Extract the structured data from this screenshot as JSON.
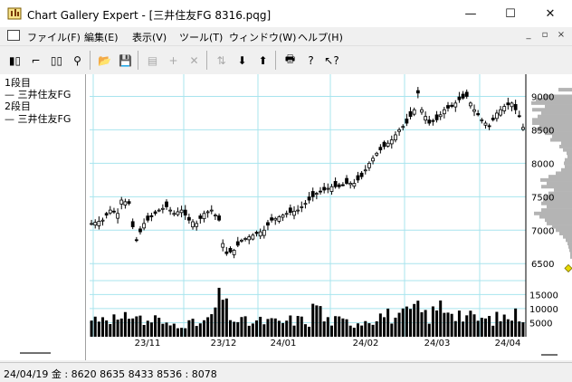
{
  "window": {
    "title": "Chart Gallery Expert - [三井住友FG 8316.pqg]",
    "minimize_glyph": "—",
    "maximize_glyph": "☐",
    "close_glyph": "✕"
  },
  "menu": {
    "items": [
      "ファイル(F)",
      "編集(E)",
      "表示(V)",
      "ツール(T)",
      "ウィンドウ(W)",
      "ヘルプ(H)"
    ],
    "mdi_minimize": "_",
    "mdi_restore": "▫",
    "mdi_close": "×"
  },
  "toolbar": {
    "buttons": [
      {
        "icon": "candlestick-chart-icon",
        "glyph": "▮▯",
        "enabled": true
      },
      {
        "icon": "step-chart-icon",
        "glyph": "⌐",
        "enabled": true
      },
      {
        "icon": "dual-pane-icon",
        "glyph": "▯▯",
        "enabled": true
      },
      {
        "icon": "binoculars-icon",
        "glyph": "⚲",
        "enabled": true
      },
      {
        "icon": "open-folder-icon",
        "glyph": "📂",
        "enabled": true
      },
      {
        "icon": "save-icon",
        "glyph": "💾",
        "enabled": true
      },
      {
        "icon": "properties-icon",
        "glyph": "▤",
        "enabled": false
      },
      {
        "icon": "add-icon",
        "glyph": "+",
        "enabled": false
      },
      {
        "icon": "delete-icon",
        "glyph": "✕",
        "enabled": false
      },
      {
        "icon": "sort-icon",
        "glyph": "⇅",
        "enabled": false
      },
      {
        "icon": "download-icon",
        "glyph": "⬇",
        "enabled": true
      },
      {
        "icon": "upload-icon",
        "glyph": "⬆",
        "enabled": true
      },
      {
        "icon": "print-icon",
        "glyph": "🖶",
        "enabled": true
      },
      {
        "icon": "help-icon",
        "glyph": "?",
        "enabled": true
      },
      {
        "icon": "context-help-icon",
        "glyph": "↖?",
        "enabled": true
      }
    ]
  },
  "left_panel": {
    "lines": [
      "1段目",
      "— 三井住友FG",
      "2段目",
      "— 三井住友FG"
    ]
  },
  "status": {
    "text": "24/04/19 金 : 8620 8635 8433 8536  : 8078"
  },
  "colors": {
    "grid": "#a8e4ee",
    "price": "#000000",
    "volume": "#000000",
    "histogram": "#b4b4b4",
    "marker": "#e6d800"
  },
  "chart_data": {
    "type": "candlestick",
    "x_ticks": [
      "23/11",
      "23/12",
      "24/01",
      "24/02",
      "24/03",
      "24/04"
    ],
    "price_ticks": [
      9000,
      8500,
      8000,
      7500,
      7000,
      6500
    ],
    "volume_ticks": [
      15000,
      10000,
      5000
    ],
    "price_range": [
      6300,
      9250
    ],
    "volume_range": [
      0,
      18000
    ],
    "grid": true,
    "series": [
      {
        "name": "三井住友FG",
        "close_keypoints": [
          [
            0,
            7100
          ],
          [
            3,
            7150
          ],
          [
            5,
            7300
          ],
          [
            7,
            7250
          ],
          [
            8,
            7450
          ],
          [
            10,
            7400
          ],
          [
            11,
            7050
          ],
          [
            12,
            6850
          ],
          [
            14,
            7100
          ],
          [
            16,
            7200
          ],
          [
            18,
            7300
          ],
          [
            20,
            7350
          ],
          [
            22,
            7250
          ],
          [
            24,
            7300
          ],
          [
            26,
            7150
          ],
          [
            28,
            7100
          ],
          [
            30,
            7250
          ],
          [
            32,
            7300
          ],
          [
            34,
            7150
          ],
          [
            35,
            6800
          ],
          [
            36,
            6650
          ],
          [
            38,
            6700
          ],
          [
            40,
            6850
          ],
          [
            42,
            6900
          ],
          [
            44,
            6950
          ],
          [
            46,
            7000
          ],
          [
            48,
            7150
          ],
          [
            50,
            7200
          ],
          [
            52,
            7250
          ],
          [
            55,
            7300
          ],
          [
            58,
            7450
          ],
          [
            60,
            7550
          ],
          [
            62,
            7600
          ],
          [
            64,
            7650
          ],
          [
            66,
            7650
          ],
          [
            68,
            7700
          ],
          [
            70,
            7700
          ],
          [
            72,
            7800
          ],
          [
            74,
            8000
          ],
          [
            76,
            8150
          ],
          [
            78,
            8250
          ],
          [
            80,
            8350
          ],
          [
            82,
            8500
          ],
          [
            84,
            8600
          ],
          [
            86,
            8800
          ],
          [
            87,
            9050
          ],
          [
            88,
            8800
          ],
          [
            89,
            8700
          ],
          [
            90,
            8600
          ],
          [
            92,
            8650
          ],
          [
            94,
            8800
          ],
          [
            96,
            8850
          ],
          [
            98,
            8950
          ],
          [
            100,
            9000
          ],
          [
            102,
            8800
          ],
          [
            104,
            8650
          ],
          [
            106,
            8550
          ],
          [
            108,
            8750
          ],
          [
            110,
            8850
          ],
          [
            112,
            8900
          ],
          [
            113,
            8800
          ],
          [
            114,
            8700
          ],
          [
            115,
            8536
          ]
        ],
        "volume_keypoints": [
          [
            0,
            6000
          ],
          [
            4,
            8000
          ],
          [
            8,
            5000
          ],
          [
            11,
            9000
          ],
          [
            14,
            5000
          ],
          [
            17,
            6500
          ],
          [
            20,
            4000
          ],
          [
            24,
            5000
          ],
          [
            28,
            4500
          ],
          [
            31,
            5500
          ],
          [
            35,
            15000
          ],
          [
            36,
            10000
          ],
          [
            38,
            6000
          ],
          [
            42,
            5000
          ],
          [
            46,
            5500
          ],
          [
            50,
            5000
          ],
          [
            54,
            6000
          ],
          [
            58,
            5500
          ],
          [
            60,
            13000
          ],
          [
            62,
            6000
          ],
          [
            66,
            5500
          ],
          [
            70,
            5000
          ],
          [
            74,
            6500
          ],
          [
            78,
            8000
          ],
          [
            82,
            6500
          ],
          [
            86,
            10000
          ],
          [
            88,
            9000
          ],
          [
            90,
            7000
          ],
          [
            93,
            11000
          ],
          [
            96,
            10000
          ],
          [
            99,
            7500
          ],
          [
            102,
            6500
          ],
          [
            106,
            6000
          ],
          [
            110,
            7000
          ],
          [
            115,
            8078
          ]
        ],
        "bars": 116
      }
    ],
    "histogram_profile": [
      [
        9100,
        15
      ],
      [
        9000,
        32
      ],
      [
        8950,
        40
      ],
      [
        8900,
        45
      ],
      [
        8850,
        30
      ],
      [
        8800,
        44
      ],
      [
        8750,
        34
      ],
      [
        8700,
        38
      ],
      [
        8650,
        44
      ],
      [
        8600,
        44
      ],
      [
        8550,
        36
      ],
      [
        8500,
        40
      ],
      [
        8450,
        30
      ],
      [
        8400,
        22
      ],
      [
        8350,
        24
      ],
      [
        8300,
        12
      ],
      [
        8250,
        14
      ],
      [
        8200,
        10
      ],
      [
        8150,
        6
      ],
      [
        8100,
        5
      ],
      [
        8050,
        8
      ],
      [
        8000,
        9
      ],
      [
        7950,
        8
      ],
      [
        7900,
        12
      ],
      [
        7850,
        18
      ],
      [
        7800,
        26
      ],
      [
        7750,
        35
      ],
      [
        7700,
        28
      ],
      [
        7650,
        34
      ],
      [
        7600,
        20
      ],
      [
        7550,
        26
      ],
      [
        7500,
        30
      ],
      [
        7450,
        32
      ],
      [
        7400,
        34
      ],
      [
        7350,
        28
      ],
      [
        7300,
        34
      ],
      [
        7250,
        42
      ],
      [
        7200,
        36
      ],
      [
        7150,
        30
      ],
      [
        7100,
        28
      ],
      [
        7050,
        22
      ],
      [
        7000,
        18
      ],
      [
        6950,
        14
      ],
      [
        6900,
        10
      ],
      [
        6850,
        7
      ],
      [
        6800,
        5
      ],
      [
        6750,
        4
      ],
      [
        6700,
        3
      ],
      [
        6650,
        2
      ],
      [
        6600,
        2
      ]
    ],
    "current_price_marker": 6430
  }
}
